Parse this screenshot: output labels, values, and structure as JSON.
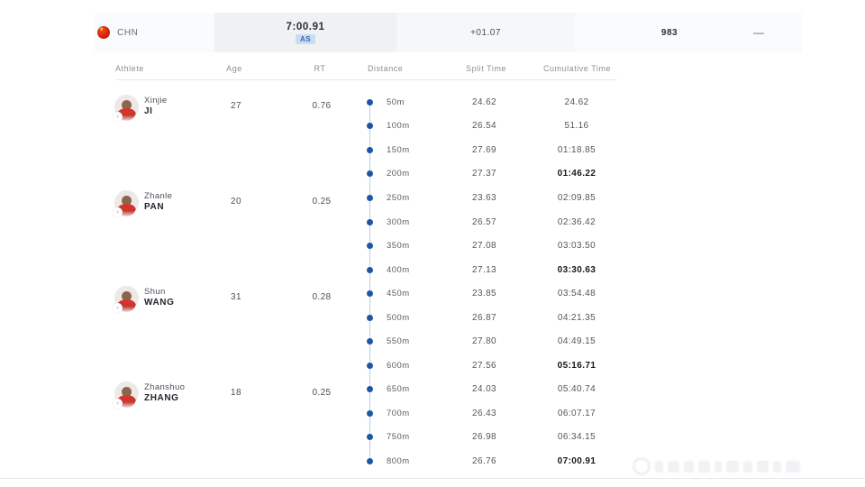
{
  "summary": {
    "team_code": "CHN",
    "final_time": "7:00.91",
    "record_badge": "AS",
    "gap_to_leader": "+01.07",
    "points": "983",
    "collapse_label": "—"
  },
  "columns": {
    "athlete": "Athlete",
    "age": "Age",
    "rt": "RT",
    "distance": "Distance",
    "split": "Split Time",
    "cumulative": "Cumulative Time"
  },
  "athletes": [
    {
      "first_name": "Xinjie",
      "last_name": "JI",
      "age": "27",
      "rt": "0.76"
    },
    {
      "first_name": "Zhanle",
      "last_name": "PAN",
      "age": "20",
      "rt": "0.25"
    },
    {
      "first_name": "Shun",
      "last_name": "WANG",
      "age": "31",
      "rt": "0.28"
    },
    {
      "first_name": "Zhanshuo",
      "last_name": "ZHANG",
      "age": "18",
      "rt": "0.25"
    }
  ],
  "splits": [
    {
      "distance": "50m",
      "split": "24.62",
      "cumulative": "24.62"
    },
    {
      "distance": "100m",
      "split": "26.54",
      "cumulative": "51.16"
    },
    {
      "distance": "150m",
      "split": "27.69",
      "cumulative": "01:18.85"
    },
    {
      "distance": "200m",
      "split": "27.37",
      "cumulative": "01:46.22"
    },
    {
      "distance": "250m",
      "split": "23.63",
      "cumulative": "02:09.85"
    },
    {
      "distance": "300m",
      "split": "26.57",
      "cumulative": "02:36.42"
    },
    {
      "distance": "350m",
      "split": "27.08",
      "cumulative": "03:03.50"
    },
    {
      "distance": "400m",
      "split": "27.13",
      "cumulative": "03:30.63"
    },
    {
      "distance": "450m",
      "split": "23.85",
      "cumulative": "03:54.48"
    },
    {
      "distance": "500m",
      "split": "26.87",
      "cumulative": "04:21.35"
    },
    {
      "distance": "550m",
      "split": "27.80",
      "cumulative": "04:49.15"
    },
    {
      "distance": "600m",
      "split": "27.56",
      "cumulative": "05:16.71"
    },
    {
      "distance": "650m",
      "split": "24.03",
      "cumulative": "05:40.74"
    },
    {
      "distance": "700m",
      "split": "26.43",
      "cumulative": "06:07.17"
    },
    {
      "distance": "750m",
      "split": "26.98",
      "cumulative": "06:34.15"
    },
    {
      "distance": "800m",
      "split": "26.76",
      "cumulative": "07:00.91"
    }
  ],
  "colors": {
    "accent_blue": "#1d56a3",
    "badge_bg": "#c9dcf2",
    "badge_text": "#3b6cb5",
    "flag_red": "#d81e06",
    "record_highlight": "#16181d"
  },
  "icons": {
    "flag": "china-flag-icon",
    "collapse": "minus-icon",
    "avatar_badge": "arrow-icon",
    "timeline_dot": "dot-icon"
  }
}
